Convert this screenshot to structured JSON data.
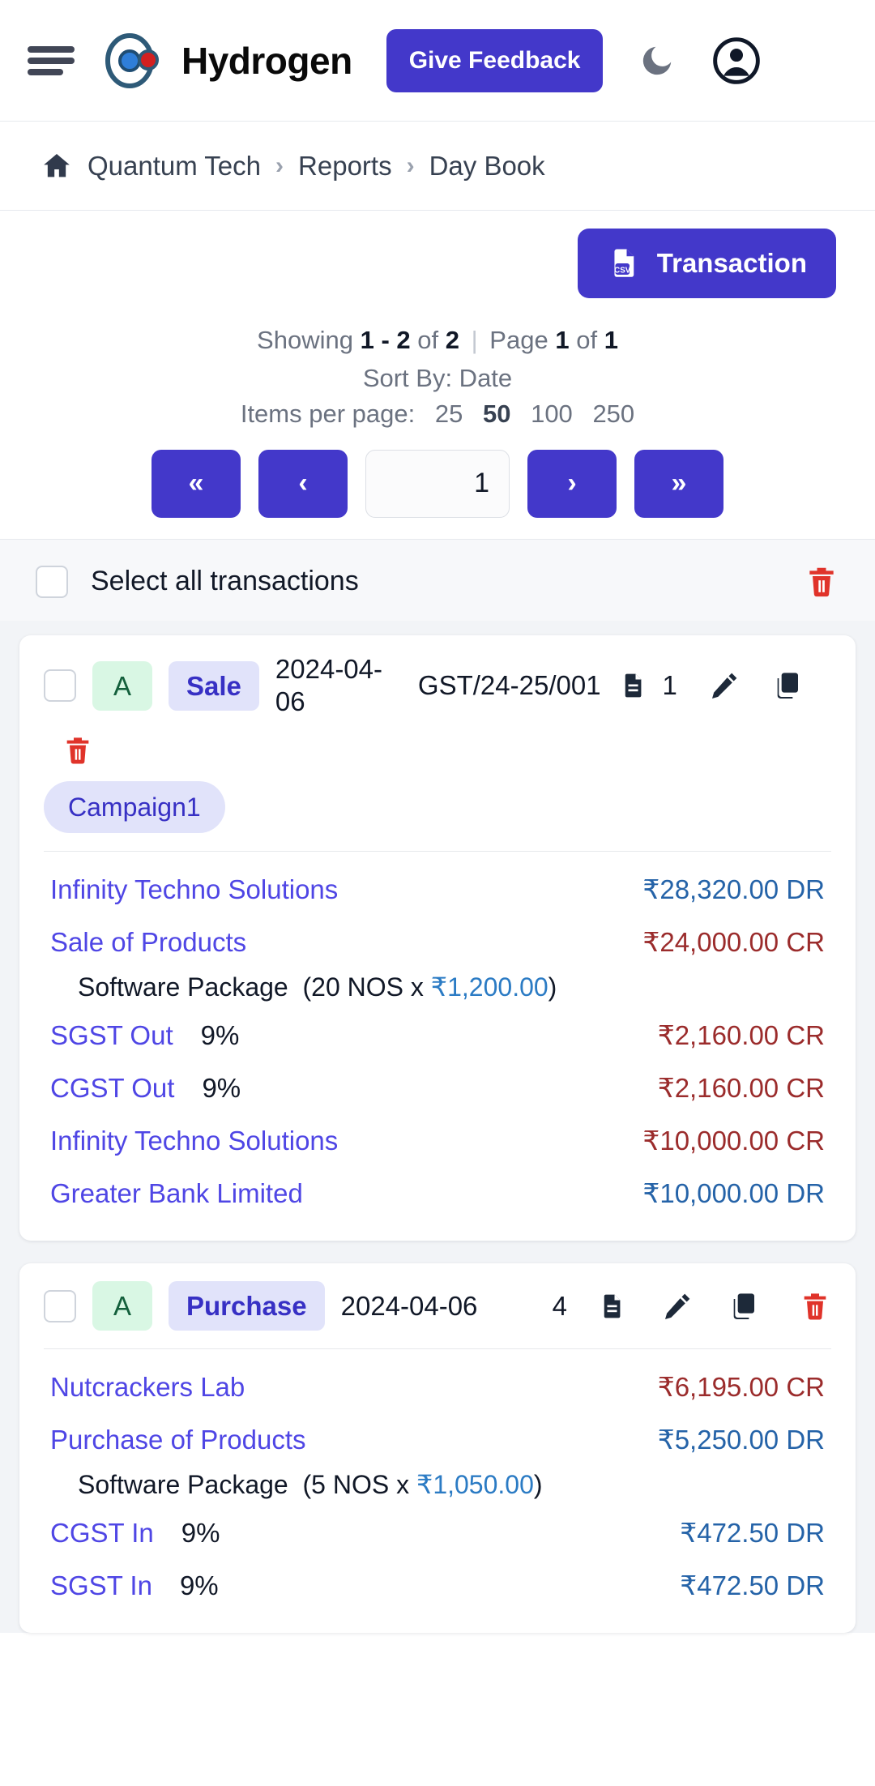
{
  "header": {
    "menu_icon": "hamburger-menu-icon",
    "logo_icon": "hydrogen-atom-logo",
    "brand": "Hydrogen",
    "feedback_label": "Give Feedback",
    "theme_icon": "moon-icon",
    "account_icon": "user-account-icon"
  },
  "breadcrumb": {
    "home_icon": "home-icon",
    "items": [
      "Quantum Tech",
      "Reports",
      "Day Book"
    ],
    "separator": "›"
  },
  "toolbar": {
    "csv_icon_label": "CSV",
    "csv_button_label": "Transaction",
    "showing_prefix": "Showing",
    "showing_range": "1 - 2",
    "of_label": "of",
    "total": "2",
    "divider": "|",
    "page_label": "Page",
    "page_current": "1",
    "page_of": "of",
    "page_total": "1",
    "sort_by": "Sort By: Date",
    "items_per_page_label": "Items per page:",
    "items_per_page_options": [
      "25",
      "50",
      "100",
      "250"
    ],
    "items_per_page_selected": "50",
    "pager": {
      "first": "«",
      "prev": "‹",
      "value": "1",
      "next": "›",
      "last": "»"
    }
  },
  "list_controls": {
    "select_all_label": "Select all transactions",
    "delete_icon": "trash-icon"
  },
  "transactions": [
    {
      "status_badge": "A",
      "type_badge": "Sale",
      "date": "2024-04-06",
      "voucher_no": "GST/24-25/001",
      "attachment_count": "1",
      "tags": [
        "Campaign1"
      ],
      "lines": [
        {
          "name": "Infinity Techno Solutions",
          "rate": "",
          "amount": "₹28,320.00 DR",
          "type": "dr",
          "item": null
        },
        {
          "name": "Sale of Products",
          "rate": "",
          "amount": "₹24,000.00 CR",
          "type": "cr",
          "item": {
            "desc": "Software Package",
            "qty": "(20 NOS x ",
            "price": "₹1,200.00",
            "close": ")"
          }
        },
        {
          "name": "SGST Out",
          "rate": "9%",
          "amount": "₹2,160.00 CR",
          "type": "cr",
          "item": null
        },
        {
          "name": "CGST Out",
          "rate": "9%",
          "amount": "₹2,160.00 CR",
          "type": "cr",
          "item": null
        },
        {
          "name": "Infinity Techno Solutions",
          "rate": "",
          "amount": "₹10,000.00 CR",
          "type": "cr",
          "item": null
        },
        {
          "name": "Greater Bank Limited",
          "rate": "",
          "amount": "₹10,000.00 DR",
          "type": "dr",
          "item": null
        }
      ]
    },
    {
      "status_badge": "A",
      "type_badge": "Purchase",
      "date": "2024-04-06",
      "voucher_no": "",
      "attachment_count": "4",
      "tags": [],
      "lines": [
        {
          "name": "Nutcrackers Lab",
          "rate": "",
          "amount": "₹6,195.00 CR",
          "type": "cr",
          "item": null
        },
        {
          "name": "Purchase of Products",
          "rate": "",
          "amount": "₹5,250.00 DR",
          "type": "dr",
          "item": {
            "desc": "Software Package",
            "qty": "(5 NOS x ",
            "price": "₹1,050.00",
            "close": ")"
          }
        },
        {
          "name": "CGST In",
          "rate": "9%",
          "amount": "₹472.50 DR",
          "type": "dr",
          "item": null
        },
        {
          "name": "SGST In",
          "rate": "9%",
          "amount": "₹472.50 DR",
          "type": "dr",
          "item": null
        }
      ]
    }
  ],
  "colors": {
    "primary": "#4338ca",
    "ledger_link": "#4f46e5",
    "debit": "#2563a8",
    "credit": "#9b2c2c",
    "danger": "#e0332a",
    "badge_green_bg": "#d9f7e4",
    "badge_green_fg": "#14603c",
    "badge_purple_bg": "#e1e3fa",
    "badge_purple_fg": "#3730c4"
  }
}
